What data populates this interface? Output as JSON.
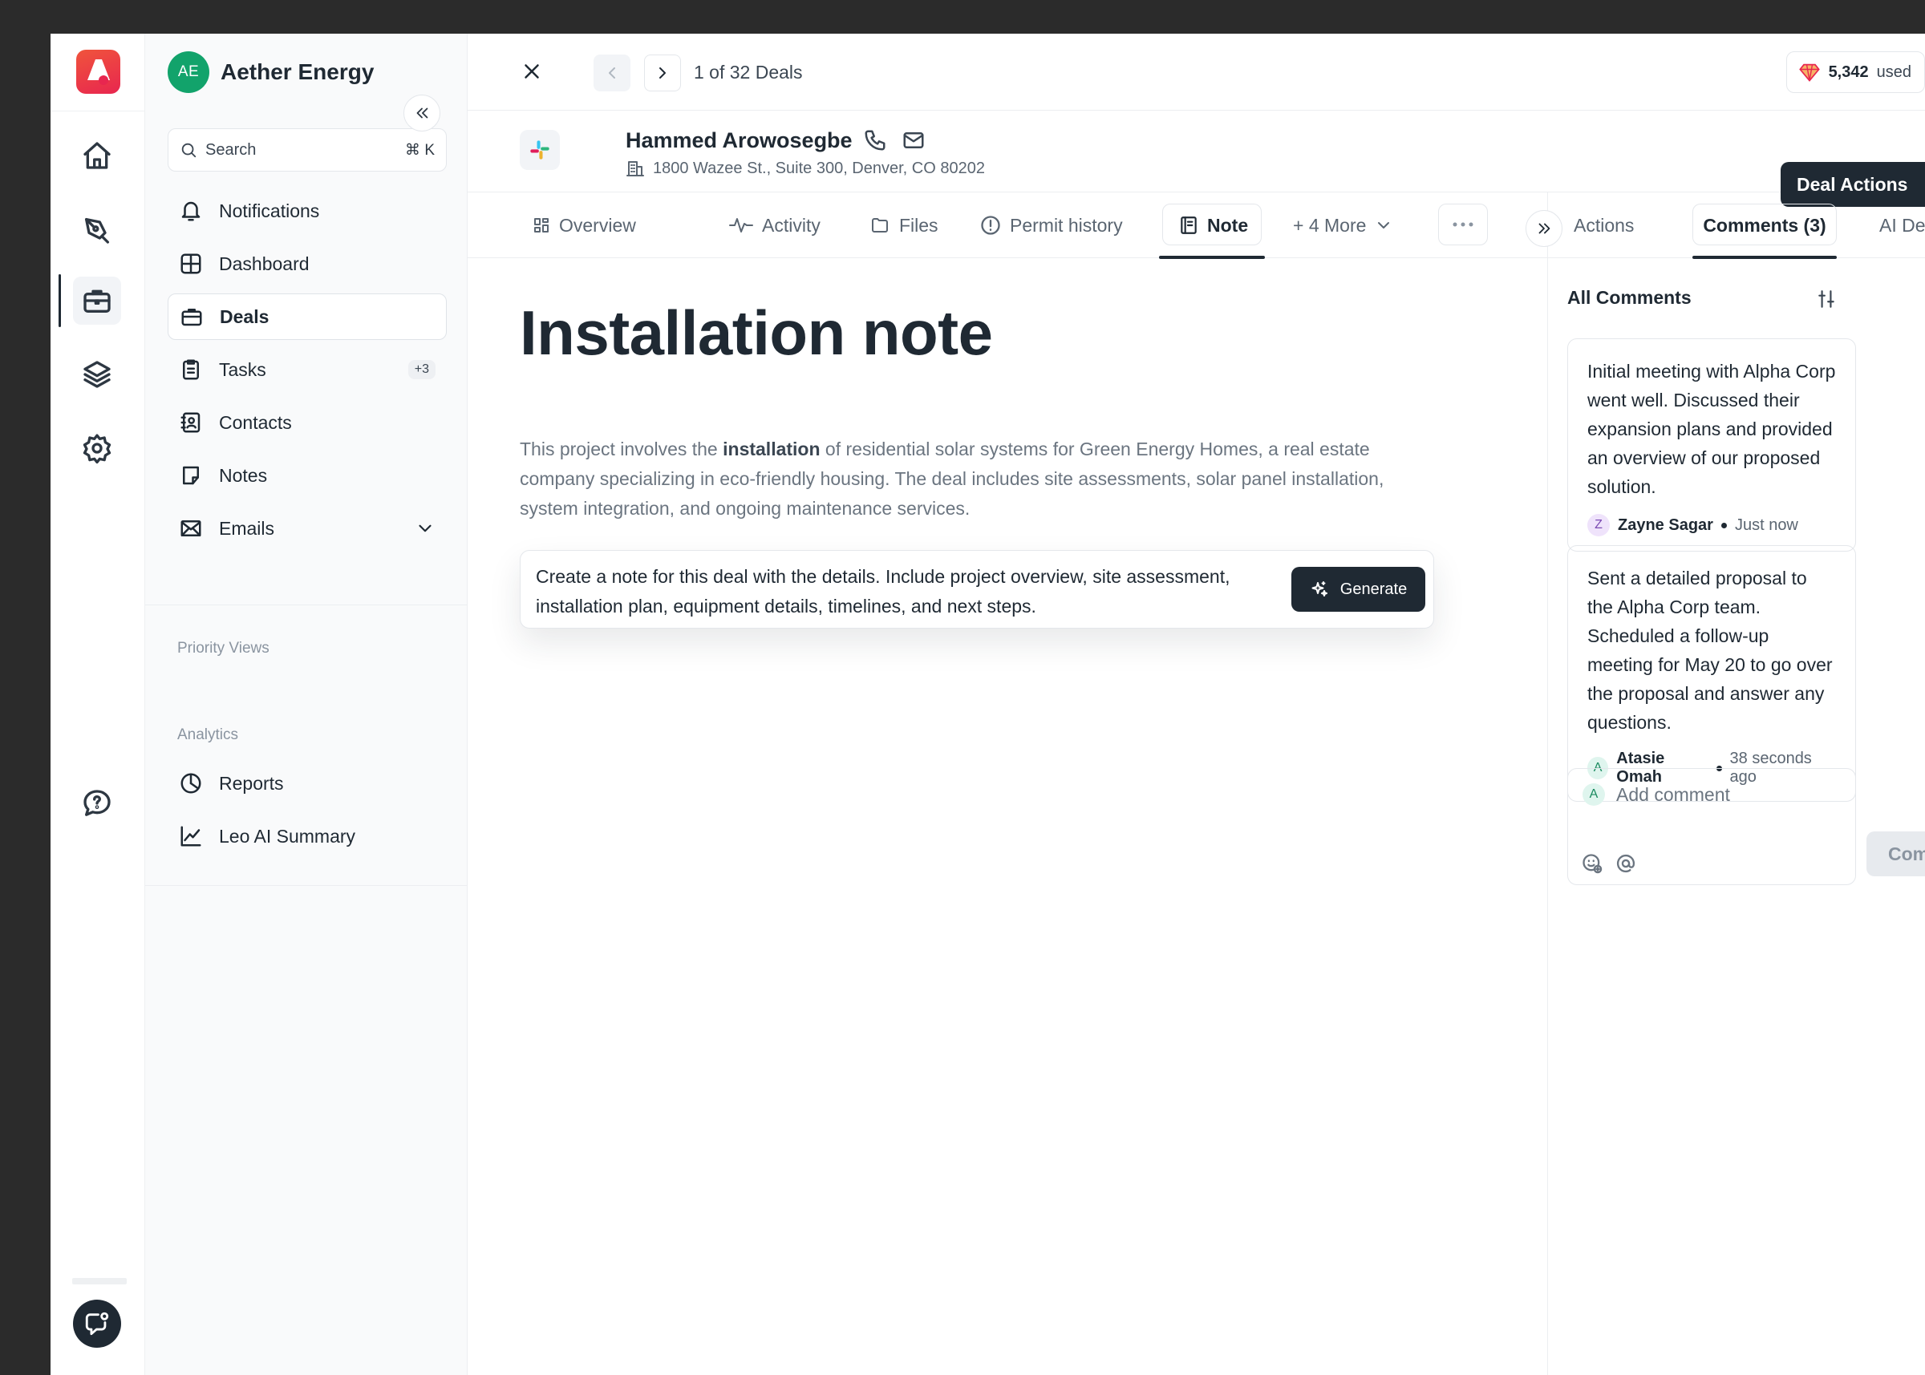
{
  "org": {
    "initials": "AE",
    "name": "Aether Energy"
  },
  "search": {
    "placeholder": "Search",
    "shortcut": "⌘ K"
  },
  "nav": {
    "items": [
      {
        "label": "Notifications",
        "icon": "bell-icon"
      },
      {
        "label": "Dashboard",
        "icon": "grid-icon"
      },
      {
        "label": "Deals",
        "icon": "briefcase-icon",
        "active": true
      },
      {
        "label": "Tasks",
        "icon": "clipboard-icon",
        "badge": "+3"
      },
      {
        "label": "Contacts",
        "icon": "contact-book-icon"
      },
      {
        "label": "Notes",
        "icon": "note-icon"
      },
      {
        "label": "Emails",
        "icon": "mail-icon",
        "expandable": true
      }
    ],
    "priority_views_label": "Priority Views",
    "analytics_label": "Analytics",
    "analytics_items": [
      {
        "label": "Reports",
        "icon": "pie-chart-icon"
      },
      {
        "label": "Leo AI Summary",
        "icon": "trend-line-icon"
      }
    ]
  },
  "header": {
    "pager_text": "1 of 32 Deals",
    "credits_value": "5,342",
    "credits_suffix": "used"
  },
  "contact": {
    "name": "Hammed Arowosegbe",
    "address": "1800 Wazee St., Suite 300, Denver, CO 80202",
    "deal_actions_label": "Deal Actions"
  },
  "tabs": [
    {
      "label": "Overview",
      "icon": "grid-small-icon"
    },
    {
      "label": "Activity",
      "icon": "activity-icon"
    },
    {
      "label": "Files",
      "icon": "folder-icon"
    },
    {
      "label": "Permit history",
      "icon": "alert-circle-icon"
    },
    {
      "label": "Note",
      "icon": "note-page-icon",
      "active": true
    },
    {
      "label": "+ 4 More",
      "icon": "chevron-down-icon"
    }
  ],
  "right_tabs": [
    {
      "label": "Actions"
    },
    {
      "label": "Comments (3)",
      "active": true
    },
    {
      "label": "AI Deal Sco"
    }
  ],
  "note": {
    "title": "Installation note",
    "body_before": "This project involves the ",
    "body_bold": "installation",
    "body_after": " of residential solar systems for Green Energy Homes, a real estate company specializing in eco-friendly housing. The deal includes site assessments, solar panel installation, system integration, and ongoing maintenance services.",
    "prompt": "Create a note for this deal with the details. Include project overview, site assessment, installation plan, equipment details, timelines, and next steps.",
    "generate_label": "Generate"
  },
  "comments": {
    "heading": "All Comments",
    "items": [
      {
        "text": "Initial meeting with Alpha Corp went well. Discussed their expansion plans and provided an overview of our proposed solution.",
        "author_initial": "Z",
        "author": "Zayne Sagar",
        "time": "Just now",
        "avatar_color": "#efe3fb",
        "avatar_text_color": "#7b4bb3"
      },
      {
        "text": "Sent a detailed proposal to the Alpha Corp team. Scheduled a follow-up meeting for May 20 to go over the proposal and answer any questions.",
        "author_initial": "A",
        "author": "Atasie Omah",
        "time": "38 seconds ago",
        "avatar_color": "#dff5ee",
        "avatar_text_color": "#1a8a5f"
      }
    ],
    "composer_initial": "A",
    "composer_placeholder": "Add comment",
    "comment_button": "Comment"
  },
  "colors": {
    "brand_gradient_start": "#f0543c",
    "brand_gradient_end": "#e8264f",
    "org_avatar": "#12a36b",
    "primary_dark": "#1f2933"
  }
}
